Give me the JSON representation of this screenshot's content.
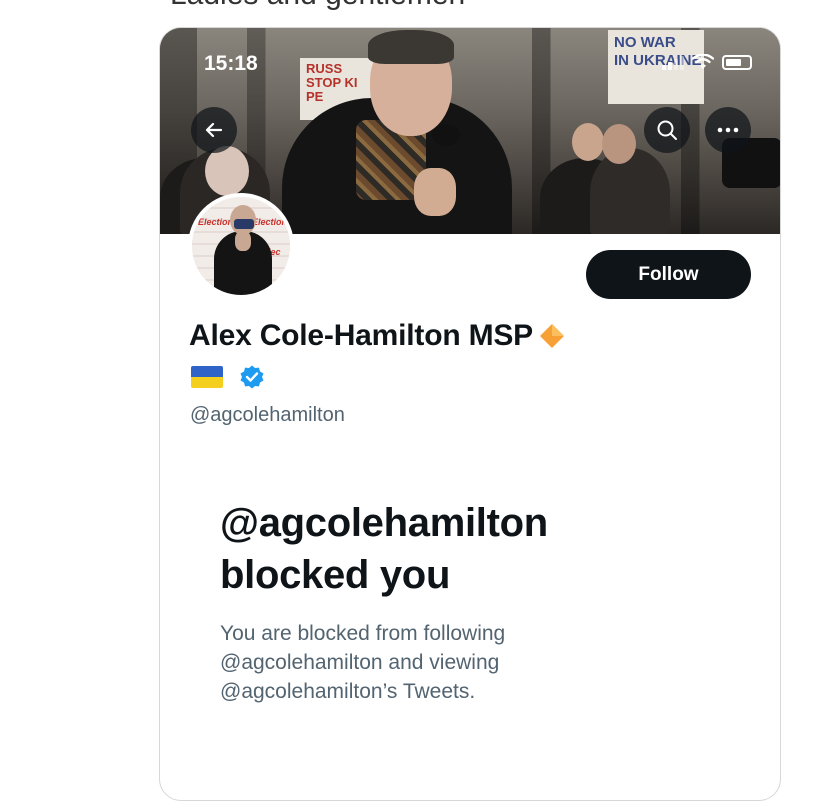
{
  "top_caption": "Ladies and gentlemen",
  "status_bar": {
    "time": "15:18"
  },
  "banner": {
    "sign_left": "RUSS\nSTOP KI\nPE",
    "sign_right": "NO WAR\nIN UKRAINE"
  },
  "avatar": {
    "text_top": "Election",
    "text_side": "Elec"
  },
  "profile": {
    "follow_label": "Follow",
    "name": "Alex Cole-Hamilton MSP",
    "handle": "@agcolehamilton"
  },
  "blocked": {
    "title_line1": "@agcolehamilton",
    "title_line2": "blocked you",
    "desc_line1": "You are blocked from following",
    "desc_line2": "@agcolehamilton and viewing",
    "desc_line3": "@agcolehamilton’s Tweets."
  },
  "colors": {
    "text_primary": "#0f1419",
    "text_secondary": "#536471",
    "verified": "#1d9bf0",
    "diamond": "#f7a035",
    "flag_blue": "#2f63c8",
    "flag_yellow": "#f5cf1d"
  },
  "icons": [
    "back-arrow-icon",
    "search-icon",
    "more-icon",
    "verified-badge-icon",
    "diamond-emoji-icon",
    "ukraine-flag-icon",
    "wifi-icon",
    "battery-icon",
    "signal-icon"
  ]
}
